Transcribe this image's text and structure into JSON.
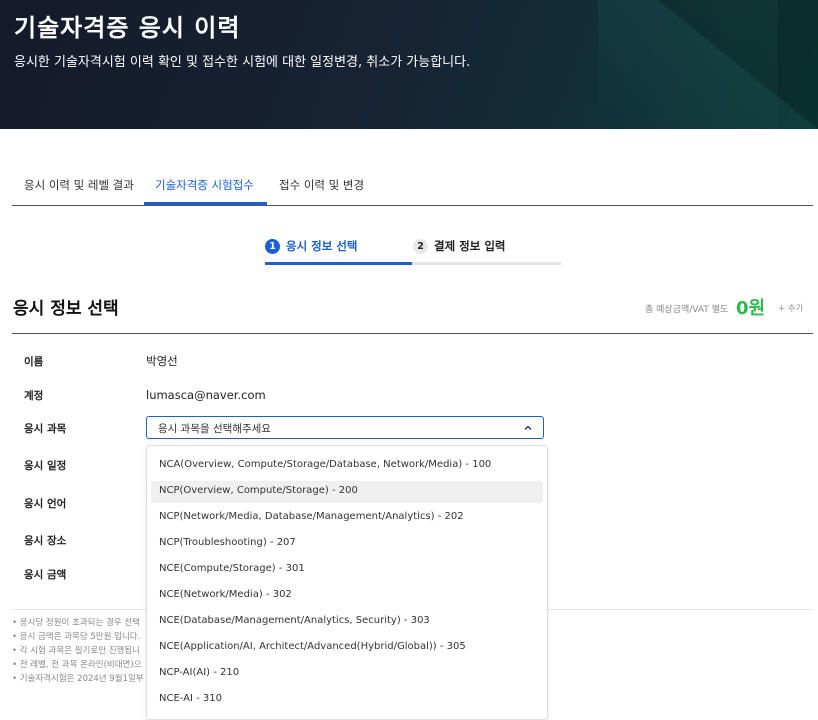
{
  "header": {
    "title": "기술자격증 응시 이력",
    "subtitle": "응시한 기술자격시험 이력 확인 및 접수한 시험에 대한 일정변경, 취소가 가능합니다."
  },
  "tabs": [
    {
      "label": "응시 이력 및 레벨 결과"
    },
    {
      "label": "기술자격증 시험접수"
    },
    {
      "label": "접수 이력 및 변경"
    }
  ],
  "steps": [
    {
      "num": "1",
      "label": "응시 정보 선택"
    },
    {
      "num": "2",
      "label": "결제 정보 입력"
    }
  ],
  "section": {
    "title": "응시 정보 선택",
    "price_label": "총 예상금액/VAT 별도",
    "price_value": "0원",
    "add_label": "+ 추가"
  },
  "form": {
    "name_label": "이름",
    "name_value": "박영선",
    "account_label": "계정",
    "account_value": "lumasca@naver.com",
    "subject_label": "응시 과목",
    "subject_placeholder": "응시 과목을 선택해주세요",
    "schedule_label": "응시 일정",
    "language_label": "응시 언어",
    "location_label": "응시 장소",
    "fee_label": "응시 금액"
  },
  "notes": [
    "• 응시당 정원이 초과되는 경우 선택",
    "• 응시 금액은 과목당 5만원 입니다.",
    "• 각 시험 과목은 필기로만 진행됩니",
    "• 전 레벨, 전 과목 온라인(비대면)으",
    "• 기술자격시험은 2024년 9월1일부"
  ],
  "dropdown": {
    "options": [
      "NCA(Overview, Compute/Storage/Database, Network/Media) - 100",
      "NCP(Overview, Compute/Storage) - 200",
      "NCP(Network/Media, Database/Management/Analytics) - 202",
      "NCP(Troubleshooting) - 207",
      "NCE(Compute/Storage) - 301",
      "NCE(Network/Media) - 302",
      "NCE(Database/Management/Analytics, Security) - 303",
      "NCE(Application/AI, Architect/Advanced(Hybrid/Global)) - 305",
      "NCP-AI(AI) - 210",
      "NCE-AI - 310"
    ],
    "highlighted_index": 1
  },
  "colors": {
    "accent": "#1a5fd6",
    "price": "#2eb84e",
    "hero_bg": "#141b2a"
  }
}
